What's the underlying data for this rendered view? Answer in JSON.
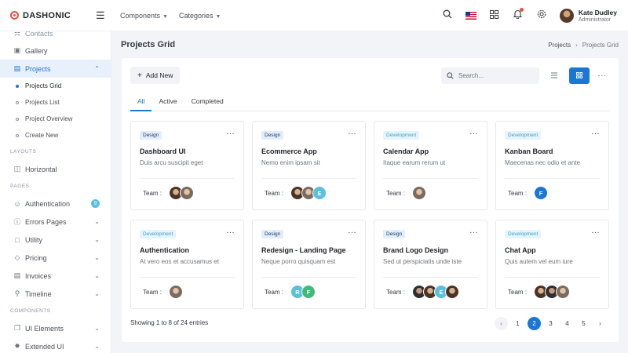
{
  "brand": {
    "name": "DASHONIC"
  },
  "topnav": [
    {
      "label": "Components"
    },
    {
      "label": "Categories"
    }
  ],
  "user": {
    "name": "Kate Dudley",
    "role": "Administrator"
  },
  "sidebar": {
    "partial_item": "Contacts",
    "gallery": "Gallery",
    "projects": "Projects",
    "sub": [
      "Projects Grid",
      "Projects List",
      "Project Overview",
      "Create New"
    ],
    "section_layouts": "LAYOUTS",
    "horizontal": "Horizontal",
    "section_pages": "PAGES",
    "authentication": "Authentication",
    "auth_badge": "9",
    "errors": "Errors Pages",
    "utility": "Utility",
    "pricing": "Pricing",
    "invoices": "Invoices",
    "timeline": "Timeline",
    "section_components": "COMPONENTS",
    "ui_elements": "UI Elements",
    "extended_ui": "Extended UI"
  },
  "page": {
    "title": "Projects Grid",
    "breadcrumb": [
      "Projects",
      "Projects Grid"
    ]
  },
  "toolbar": {
    "add_label": "Add New",
    "search_placeholder": "Search..."
  },
  "tabs": [
    "All",
    "Active",
    "Completed"
  ],
  "team_label": "Team :",
  "projects": [
    {
      "tag": "Design",
      "title": "Dashboard UI",
      "desc": "Duis arcu suscipit eget"
    },
    {
      "tag": "Design",
      "title": "Ecommerce App",
      "desc": "Nemo enim ipsam sit",
      "letter": "E"
    },
    {
      "tag": "Development",
      "title": "Calendar App",
      "desc": "Itaque earum rerum ut"
    },
    {
      "tag": "Development",
      "title": "Kanban Board",
      "desc": "Maecenas nec odio et ante",
      "letter": "F"
    },
    {
      "tag": "Development",
      "title": "Authentication",
      "desc": "At vero eos et accusamus et"
    },
    {
      "tag": "Design",
      "title": "Redesign - Landing Page",
      "desc": "Neque porro quisquam est",
      "letters": [
        "R",
        "F"
      ]
    },
    {
      "tag": "Design",
      "title": "Brand Logo Design",
      "desc": "Sed ut perspiciatis unde iste",
      "letter": "E"
    },
    {
      "tag": "Development",
      "title": "Chat App",
      "desc": "Quis autem vel eum iure"
    }
  ],
  "footer": {
    "info": "Showing 1 to 8 of 24 entries"
  },
  "pagination": {
    "pages": [
      "1",
      "2",
      "3",
      "4",
      "5"
    ],
    "current": "2"
  },
  "colors": {
    "primary": "#1a77d4",
    "brand_logo": "#e5533d"
  }
}
